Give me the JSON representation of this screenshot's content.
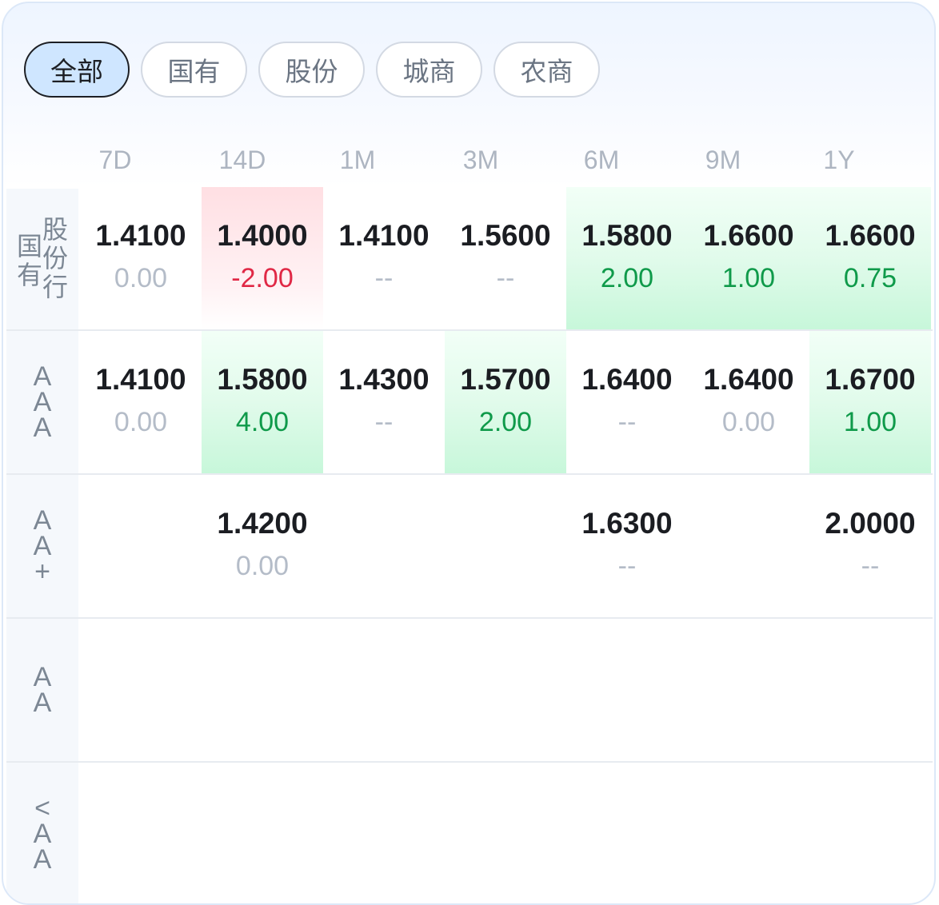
{
  "tabs": [
    {
      "label": "全部",
      "active": true
    },
    {
      "label": "国有",
      "active": false
    },
    {
      "label": "股份",
      "active": false
    },
    {
      "label": "城商",
      "active": false
    },
    {
      "label": "农商",
      "active": false
    }
  ],
  "columns": [
    "7D",
    "14D",
    "1M",
    "3M",
    "6M",
    "9M",
    "1Y"
  ],
  "rows": [
    {
      "label_left": "国有",
      "label_right": "股份行",
      "cells": [
        {
          "value": "1.4100",
          "change": "0.00",
          "trend": "flat"
        },
        {
          "value": "1.4000",
          "change": "-2.00",
          "trend": "down"
        },
        {
          "value": "1.4100",
          "change": "--",
          "trend": "flat"
        },
        {
          "value": "1.5600",
          "change": "--",
          "trend": "flat"
        },
        {
          "value": "1.5800",
          "change": "2.00",
          "trend": "up"
        },
        {
          "value": "1.6600",
          "change": "1.00",
          "trend": "up"
        },
        {
          "value": "1.6600",
          "change": "0.75",
          "trend": "up"
        }
      ]
    },
    {
      "label": "AAA",
      "cells": [
        {
          "value": "1.4100",
          "change": "0.00",
          "trend": "flat"
        },
        {
          "value": "1.5800",
          "change": "4.00",
          "trend": "up"
        },
        {
          "value": "1.4300",
          "change": "--",
          "trend": "flat"
        },
        {
          "value": "1.5700",
          "change": "2.00",
          "trend": "up"
        },
        {
          "value": "1.6400",
          "change": "--",
          "trend": "flat"
        },
        {
          "value": "1.6400",
          "change": "0.00",
          "trend": "flat"
        },
        {
          "value": "1.6700",
          "change": "1.00",
          "trend": "up"
        }
      ]
    },
    {
      "label": "AA+",
      "cells": [
        {
          "value": "",
          "change": "",
          "trend": "flat"
        },
        {
          "value": "1.4200",
          "change": "0.00",
          "trend": "flat"
        },
        {
          "value": "",
          "change": "",
          "trend": "flat"
        },
        {
          "value": "",
          "change": "",
          "trend": "flat"
        },
        {
          "value": "1.6300",
          "change": "--",
          "trend": "flat"
        },
        {
          "value": "",
          "change": "",
          "trend": "flat"
        },
        {
          "value": "2.0000",
          "change": "--",
          "trend": "flat"
        }
      ]
    },
    {
      "label": "AA",
      "cells": [
        {
          "value": "",
          "change": "",
          "trend": "flat"
        },
        {
          "value": "",
          "change": "",
          "trend": "flat"
        },
        {
          "value": "",
          "change": "",
          "trend": "flat"
        },
        {
          "value": "",
          "change": "",
          "trend": "flat"
        },
        {
          "value": "",
          "change": "",
          "trend": "flat"
        },
        {
          "value": "",
          "change": "",
          "trend": "flat"
        },
        {
          "value": "",
          "change": "",
          "trend": "flat"
        }
      ]
    },
    {
      "label": "<AA",
      "cells": [
        {
          "value": "",
          "change": "",
          "trend": "flat"
        },
        {
          "value": "",
          "change": "",
          "trend": "flat"
        },
        {
          "value": "",
          "change": "",
          "trend": "flat"
        },
        {
          "value": "",
          "change": "",
          "trend": "flat"
        },
        {
          "value": "",
          "change": "",
          "trend": "flat"
        },
        {
          "value": "",
          "change": "",
          "trend": "flat"
        },
        {
          "value": "",
          "change": "",
          "trend": "flat"
        }
      ]
    }
  ],
  "colors": {
    "up": "#0f9a4a",
    "down": "#e02845",
    "flat": "#b4bcc8",
    "active_tab_bg": "#cfe6ff"
  }
}
